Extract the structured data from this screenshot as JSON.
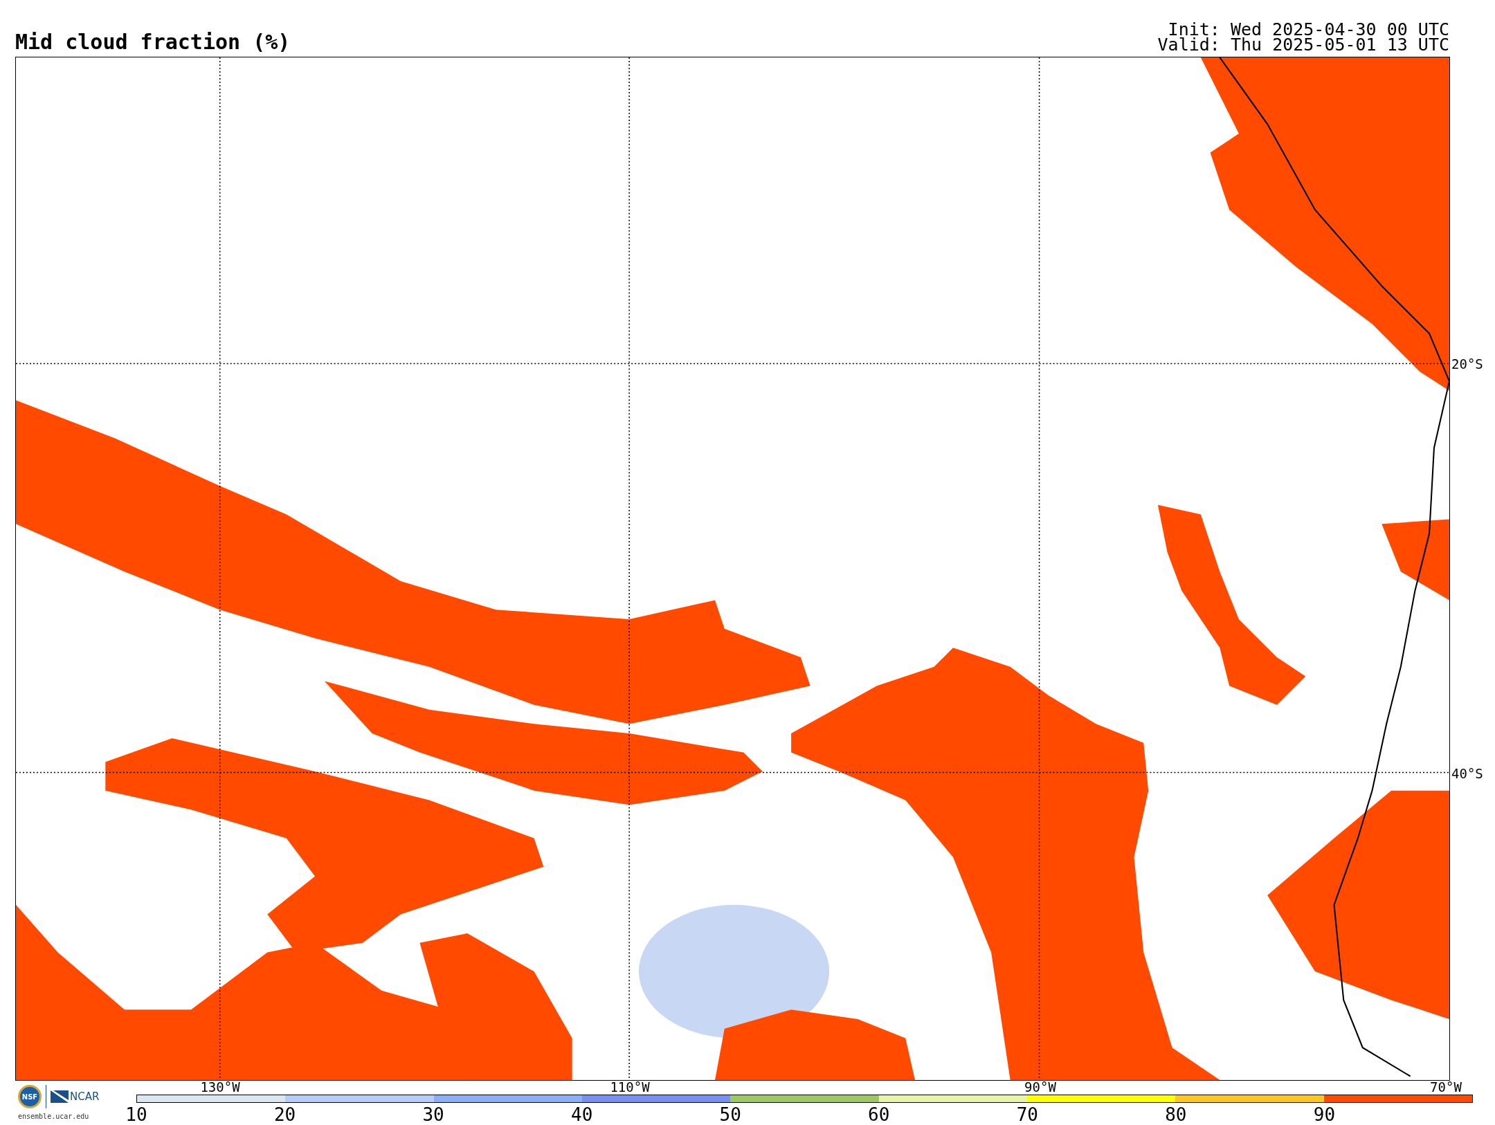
{
  "title": "Mid cloud fraction (%)",
  "init": "Init: Wed 2025-04-30 00 UTC",
  "valid": "Valid: Thu 2025-05-01 13 UTC",
  "map": {
    "lat_labels": [
      "20°S",
      "40°S"
    ],
    "lon_labels": [
      "130°W",
      "110°W",
      "90°W",
      "70°W"
    ]
  },
  "logos": {
    "seal": "NSF",
    "org": "NCAR",
    "url": "ensemble.ucar.edu"
  },
  "colorbar": {
    "segments": [
      {
        "color": "#dce6ee"
      },
      {
        "color": "#b8ccf8"
      },
      {
        "color": "#8cb0f8"
      },
      {
        "color": "#7890f0"
      },
      {
        "color": "#a0c860"
      },
      {
        "color": "#e8f5a8"
      },
      {
        "color": "#ffff00"
      },
      {
        "color": "#ffc820"
      },
      {
        "color": "#ff4a00"
      }
    ],
    "ticks": [
      "10",
      "20",
      "30",
      "40",
      "50",
      "60",
      "70",
      "80",
      "90"
    ]
  }
}
